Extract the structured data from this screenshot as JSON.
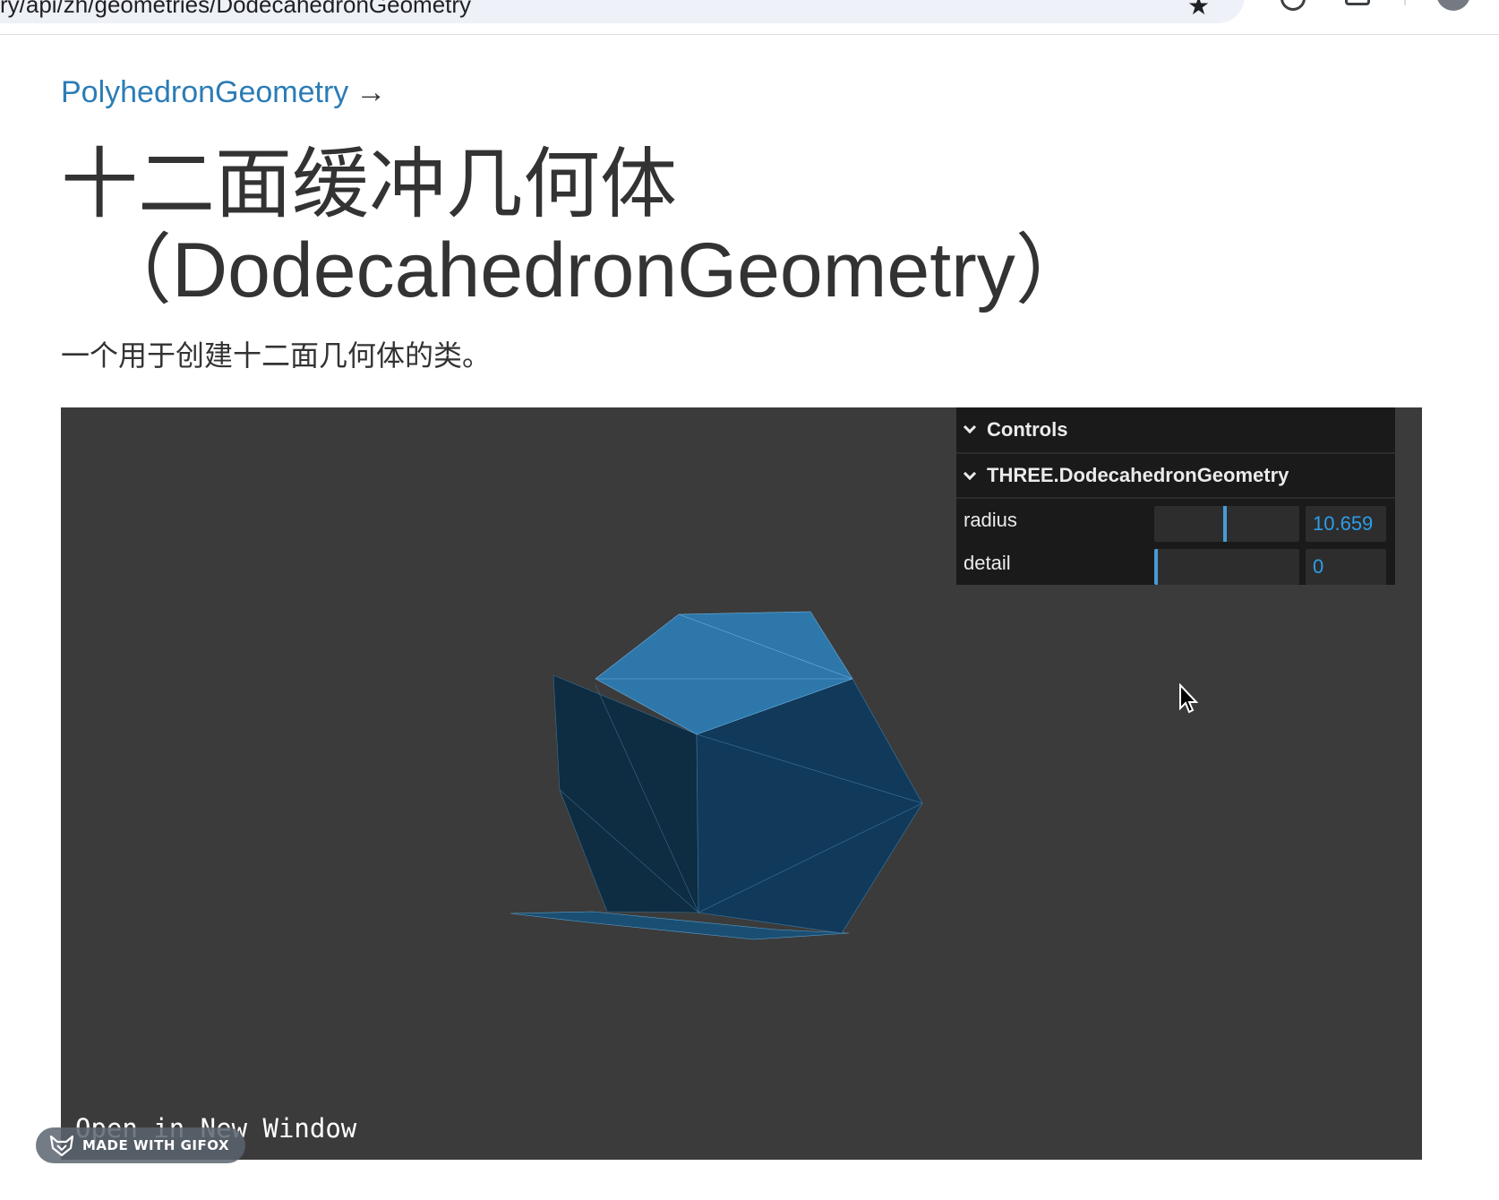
{
  "browser": {
    "address_text": "ry/api/zh/geometries/DodecahedronGeometry"
  },
  "page": {
    "breadcrumb": {
      "label": "PolyhedronGeometry",
      "arrow": "→"
    },
    "title_line1": "十二面缓冲几何体",
    "title_line2": "（DodecahedronGeometry）",
    "description": "一个用于创建十二面几何体的类。"
  },
  "viewer": {
    "open_link": "Open in New Window",
    "background_color": "#3b3b3b",
    "mesh_color": "#2d7fb8"
  },
  "gui": {
    "header": "Controls",
    "folder": "THREE.DodecahedronGeometry",
    "rows": [
      {
        "label": "radius",
        "value": "10.659",
        "fraction": 0.5
      },
      {
        "label": "detail",
        "value": "0",
        "fraction": 0.0
      }
    ]
  },
  "badge": {
    "text": "MADE WITH GIFOX"
  },
  "icons": [
    "star-icon",
    "extension-icon",
    "downloads-icon",
    "profile-avatar",
    "chevron-down-icon",
    "mouse-cursor-icon",
    "gifox-logo-icon"
  ]
}
